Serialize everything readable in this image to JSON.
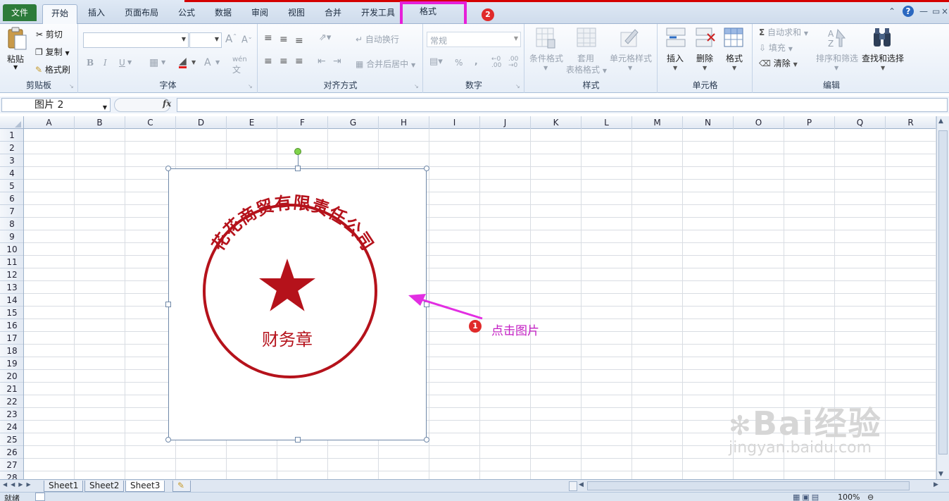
{
  "tabs": {
    "file": "文件",
    "home": "开始",
    "insert": "插入",
    "page_layout": "页面布局",
    "formulas": "公式",
    "data": "数据",
    "review": "审阅",
    "view": "视图",
    "merge": "合并",
    "developer": "开发工具",
    "format": "格式"
  },
  "ribbon": {
    "clipboard": {
      "group": "剪贴板",
      "paste": "粘贴",
      "cut": "剪切",
      "copy": "复制",
      "painter": "格式刷"
    },
    "font": {
      "group": "字体",
      "bold": "B",
      "italic": "I",
      "underline": "U",
      "grow": "A",
      "shrink": "A",
      "pinyin": "wén"
    },
    "align": {
      "group": "对齐方式",
      "wrap": "自动换行",
      "merge": "合并后居中"
    },
    "number": {
      "group": "数字",
      "format_value": "常规",
      "percent": "%",
      "comma": ","
    },
    "styles": {
      "group": "样式",
      "cond_format": "条件格式",
      "table_format_1": "套用",
      "table_format_2": "表格格式",
      "cell_styles": "单元格样式"
    },
    "cells": {
      "group": "单元格",
      "insert": "插入",
      "delete": "删除",
      "format": "格式"
    },
    "editing": {
      "group": "编辑",
      "autosum": "自动求和",
      "fill": "填充",
      "clear": "清除",
      "sort": "排序和筛选",
      "find": "查找和选择"
    }
  },
  "namebox": {
    "value": "图片 2"
  },
  "fx": "fx",
  "columns": [
    "A",
    "B",
    "C",
    "D",
    "E",
    "F",
    "G",
    "H",
    "I",
    "J",
    "K",
    "L",
    "M",
    "N",
    "O",
    "P",
    "Q",
    "R"
  ],
  "rows": [
    "1",
    "2",
    "3",
    "4",
    "5",
    "6",
    "7",
    "8",
    "9",
    "10",
    "11",
    "12",
    "13",
    "14",
    "15",
    "16",
    "17",
    "18",
    "19",
    "20",
    "21",
    "22",
    "23",
    "24",
    "25",
    "26",
    "27",
    "28"
  ],
  "sheets": [
    "Sheet1",
    "Sheet2",
    "Sheet3"
  ],
  "active_sheet": "Sheet3",
  "stamp": {
    "company": "花花商贸有限责任公司",
    "name": "财务章",
    "color": "#b5121b"
  },
  "annotations": {
    "badge1": "1",
    "badge2": "2",
    "step1_text": "点击图片",
    "highlight_color": "#e61fd8"
  },
  "status": {
    "ready": "就绪",
    "zoom": "100%"
  },
  "watermark": {
    "brand": "Bai经验",
    "url": "jingyan.baidu.com"
  }
}
